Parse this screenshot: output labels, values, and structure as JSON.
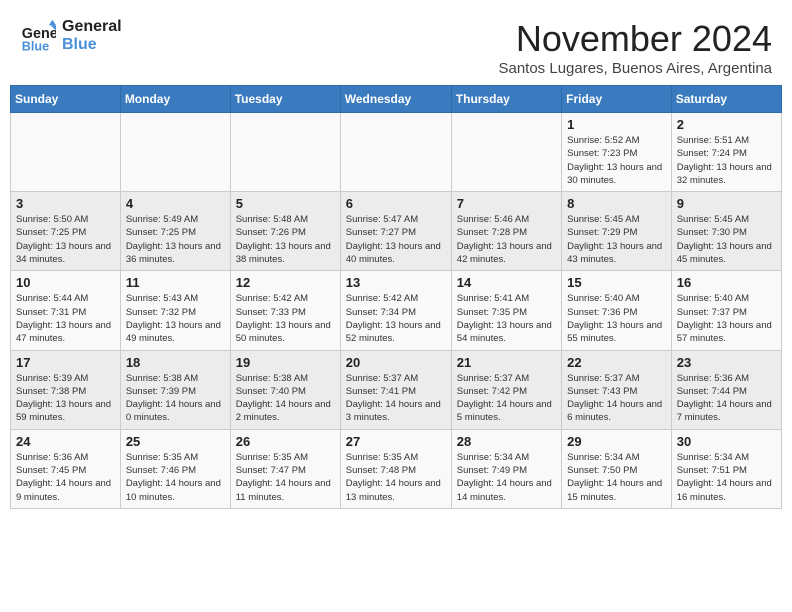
{
  "header": {
    "logo_line1": "General",
    "logo_line2": "Blue",
    "month": "November 2024",
    "location": "Santos Lugares, Buenos Aires, Argentina"
  },
  "days_of_week": [
    "Sunday",
    "Monday",
    "Tuesday",
    "Wednesday",
    "Thursday",
    "Friday",
    "Saturday"
  ],
  "weeks": [
    [
      {
        "num": "",
        "info": ""
      },
      {
        "num": "",
        "info": ""
      },
      {
        "num": "",
        "info": ""
      },
      {
        "num": "",
        "info": ""
      },
      {
        "num": "",
        "info": ""
      },
      {
        "num": "1",
        "info": "Sunrise: 5:52 AM\nSunset: 7:23 PM\nDaylight: 13 hours and 30 minutes."
      },
      {
        "num": "2",
        "info": "Sunrise: 5:51 AM\nSunset: 7:24 PM\nDaylight: 13 hours and 32 minutes."
      }
    ],
    [
      {
        "num": "3",
        "info": "Sunrise: 5:50 AM\nSunset: 7:25 PM\nDaylight: 13 hours and 34 minutes."
      },
      {
        "num": "4",
        "info": "Sunrise: 5:49 AM\nSunset: 7:25 PM\nDaylight: 13 hours and 36 minutes."
      },
      {
        "num": "5",
        "info": "Sunrise: 5:48 AM\nSunset: 7:26 PM\nDaylight: 13 hours and 38 minutes."
      },
      {
        "num": "6",
        "info": "Sunrise: 5:47 AM\nSunset: 7:27 PM\nDaylight: 13 hours and 40 minutes."
      },
      {
        "num": "7",
        "info": "Sunrise: 5:46 AM\nSunset: 7:28 PM\nDaylight: 13 hours and 42 minutes."
      },
      {
        "num": "8",
        "info": "Sunrise: 5:45 AM\nSunset: 7:29 PM\nDaylight: 13 hours and 43 minutes."
      },
      {
        "num": "9",
        "info": "Sunrise: 5:45 AM\nSunset: 7:30 PM\nDaylight: 13 hours and 45 minutes."
      }
    ],
    [
      {
        "num": "10",
        "info": "Sunrise: 5:44 AM\nSunset: 7:31 PM\nDaylight: 13 hours and 47 minutes."
      },
      {
        "num": "11",
        "info": "Sunrise: 5:43 AM\nSunset: 7:32 PM\nDaylight: 13 hours and 49 minutes."
      },
      {
        "num": "12",
        "info": "Sunrise: 5:42 AM\nSunset: 7:33 PM\nDaylight: 13 hours and 50 minutes."
      },
      {
        "num": "13",
        "info": "Sunrise: 5:42 AM\nSunset: 7:34 PM\nDaylight: 13 hours and 52 minutes."
      },
      {
        "num": "14",
        "info": "Sunrise: 5:41 AM\nSunset: 7:35 PM\nDaylight: 13 hours and 54 minutes."
      },
      {
        "num": "15",
        "info": "Sunrise: 5:40 AM\nSunset: 7:36 PM\nDaylight: 13 hours and 55 minutes."
      },
      {
        "num": "16",
        "info": "Sunrise: 5:40 AM\nSunset: 7:37 PM\nDaylight: 13 hours and 57 minutes."
      }
    ],
    [
      {
        "num": "17",
        "info": "Sunrise: 5:39 AM\nSunset: 7:38 PM\nDaylight: 13 hours and 59 minutes."
      },
      {
        "num": "18",
        "info": "Sunrise: 5:38 AM\nSunset: 7:39 PM\nDaylight: 14 hours and 0 minutes."
      },
      {
        "num": "19",
        "info": "Sunrise: 5:38 AM\nSunset: 7:40 PM\nDaylight: 14 hours and 2 minutes."
      },
      {
        "num": "20",
        "info": "Sunrise: 5:37 AM\nSunset: 7:41 PM\nDaylight: 14 hours and 3 minutes."
      },
      {
        "num": "21",
        "info": "Sunrise: 5:37 AM\nSunset: 7:42 PM\nDaylight: 14 hours and 5 minutes."
      },
      {
        "num": "22",
        "info": "Sunrise: 5:37 AM\nSunset: 7:43 PM\nDaylight: 14 hours and 6 minutes."
      },
      {
        "num": "23",
        "info": "Sunrise: 5:36 AM\nSunset: 7:44 PM\nDaylight: 14 hours and 7 minutes."
      }
    ],
    [
      {
        "num": "24",
        "info": "Sunrise: 5:36 AM\nSunset: 7:45 PM\nDaylight: 14 hours and 9 minutes."
      },
      {
        "num": "25",
        "info": "Sunrise: 5:35 AM\nSunset: 7:46 PM\nDaylight: 14 hours and 10 minutes."
      },
      {
        "num": "26",
        "info": "Sunrise: 5:35 AM\nSunset: 7:47 PM\nDaylight: 14 hours and 11 minutes."
      },
      {
        "num": "27",
        "info": "Sunrise: 5:35 AM\nSunset: 7:48 PM\nDaylight: 14 hours and 13 minutes."
      },
      {
        "num": "28",
        "info": "Sunrise: 5:34 AM\nSunset: 7:49 PM\nDaylight: 14 hours and 14 minutes."
      },
      {
        "num": "29",
        "info": "Sunrise: 5:34 AM\nSunset: 7:50 PM\nDaylight: 14 hours and 15 minutes."
      },
      {
        "num": "30",
        "info": "Sunrise: 5:34 AM\nSunset: 7:51 PM\nDaylight: 14 hours and 16 minutes."
      }
    ]
  ]
}
